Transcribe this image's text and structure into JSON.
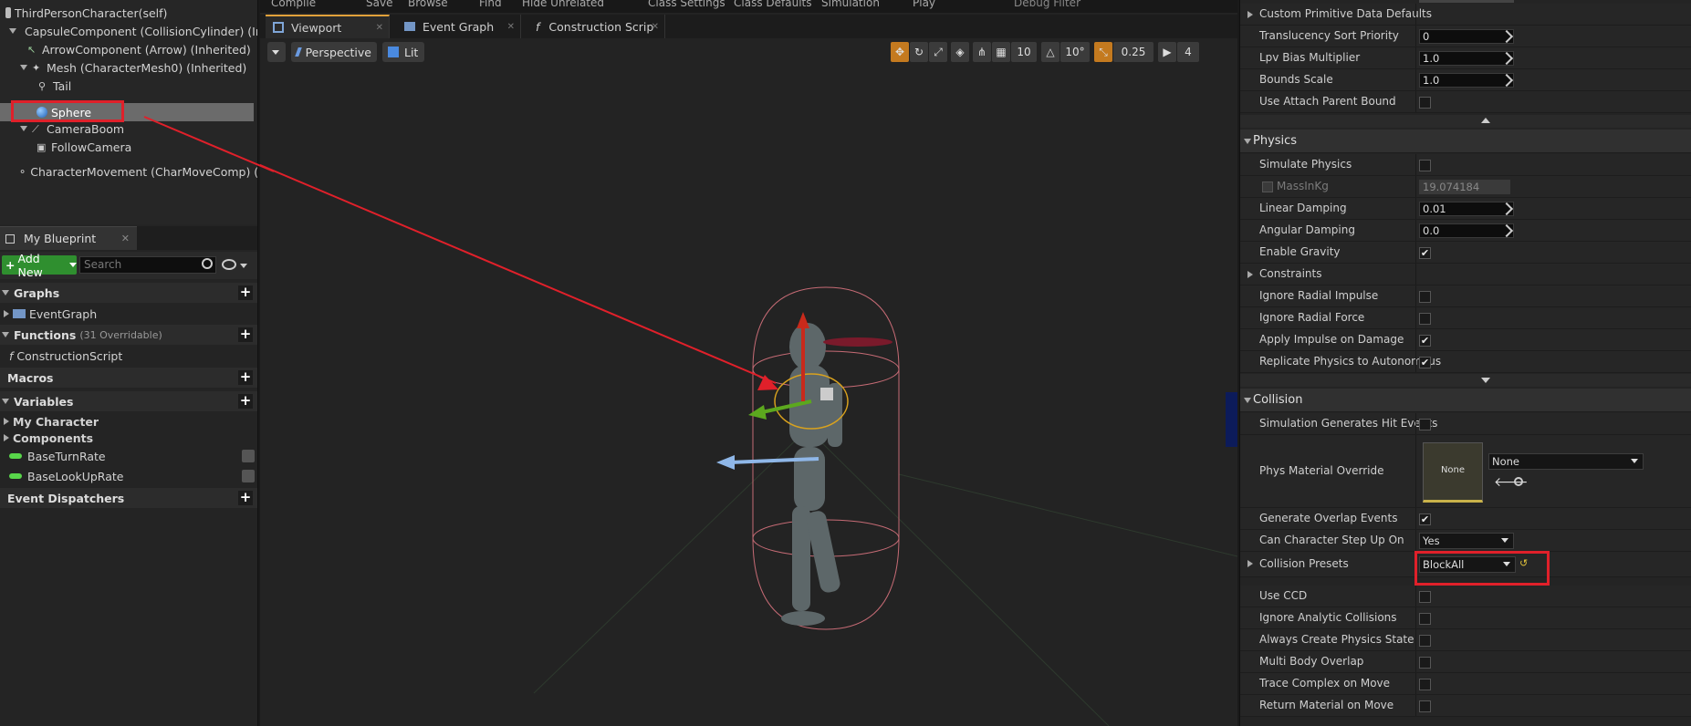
{
  "components": {
    "items": [
      {
        "label": "ThirdPersonCharacter(self)"
      },
      {
        "label": "CapsuleComponent (CollisionCylinder) (Inhe"
      },
      {
        "label": "ArrowComponent (Arrow) (Inherited)"
      },
      {
        "label": "Mesh (CharacterMesh0) (Inherited)"
      },
      {
        "label": "Tail"
      },
      {
        "label": "Sphere"
      },
      {
        "label": "CameraBoom"
      },
      {
        "label": "FollowCamera"
      },
      {
        "label": "CharacterMovement (CharMoveComp) (Inher"
      }
    ]
  },
  "blueprint": {
    "tab_label": "My Blueprint",
    "add_new_label": "Add New",
    "search_placeholder": "Search",
    "sections": {
      "graphs": "Graphs",
      "event_graph": "EventGraph",
      "functions": "Functions",
      "functions_count": "(31 Overridable)",
      "construction_script": "ConstructionScript",
      "macros": "Macros",
      "variables": "Variables",
      "my_character": "My Character",
      "components": "Components",
      "var1": "BaseTurnRate",
      "var2": "BaseLookUpRate",
      "event_dispatchers": "Event Dispatchers"
    }
  },
  "toolbar_top": {
    "items": [
      "Compile",
      "Save",
      "Browse",
      "Find",
      "Hide Unrelated",
      "Class Settings",
      "Class Defaults",
      "Simulation",
      "Play",
      "Debug Filter"
    ]
  },
  "viewport": {
    "tabs": [
      "Viewport",
      "Event Graph",
      "Construction Scrip"
    ],
    "perspective_label": "Perspective",
    "lit_label": "Lit",
    "grid_snap": "10",
    "rot_snap": "10°",
    "scale_snap": "0.25",
    "cam_speed": "4"
  },
  "details": {
    "rows_top": [
      {
        "label": "Custom Primitive Data Defaults",
        "type": "expand"
      },
      {
        "label": "Translucency Sort Priority",
        "type": "input",
        "value": "0"
      },
      {
        "label": "Lpv Bias Multiplier",
        "type": "input",
        "value": "1.0"
      },
      {
        "label": "Bounds Scale",
        "type": "input",
        "value": "1.0"
      },
      {
        "label": "Use Attach Parent Bound",
        "type": "check",
        "value": ""
      }
    ],
    "physics_title": "Physics",
    "physics_rows": [
      {
        "label": "Simulate Physics",
        "value": ""
      },
      {
        "label": "MassInKg",
        "value": "19.074184"
      },
      {
        "label": "Linear Damping",
        "value": "0.01"
      },
      {
        "label": "Angular Damping",
        "value": "0.0"
      },
      {
        "label": "Enable Gravity",
        "value": "✔"
      },
      {
        "label": "Constraints",
        "value": ""
      },
      {
        "label": "Ignore Radial Impulse",
        "value": ""
      },
      {
        "label": "Ignore Radial Force",
        "value": ""
      },
      {
        "label": "Apply Impulse on Damage",
        "value": "✔"
      },
      {
        "label": "Replicate Physics to Autonomous",
        "value": "✔"
      }
    ],
    "collision_title": "Collision",
    "collision_rows": {
      "sim_hit": {
        "label": "Simulation Generates Hit Events",
        "value": ""
      },
      "phys_mat": {
        "label": "Phys Material Override",
        "thumb": "None",
        "select": "None"
      },
      "gen_overlap": {
        "label": "Generate Overlap Events",
        "value": "✔"
      },
      "step_up": {
        "label": "Can Character Step Up On",
        "value": "Yes"
      },
      "presets": {
        "label": "Collision Presets",
        "value": "BlockAll"
      },
      "use_ccd": {
        "label": "Use CCD",
        "value": ""
      },
      "ignore_analytic": {
        "label": "Ignore Analytic Collisions",
        "value": ""
      },
      "always_create": {
        "label": "Always Create Physics State",
        "value": ""
      },
      "multi_body": {
        "label": "Multi Body Overlap",
        "value": ""
      },
      "trace_complex": {
        "label": "Trace Complex on Move",
        "value": ""
      },
      "return_material": {
        "label": "Return Material on Move",
        "value": ""
      }
    }
  },
  "colors": {
    "accent": "#e1a13a",
    "annotation_red": "#e0202a",
    "add_green": "#2f8f2f",
    "var_green": "#58d64a"
  }
}
